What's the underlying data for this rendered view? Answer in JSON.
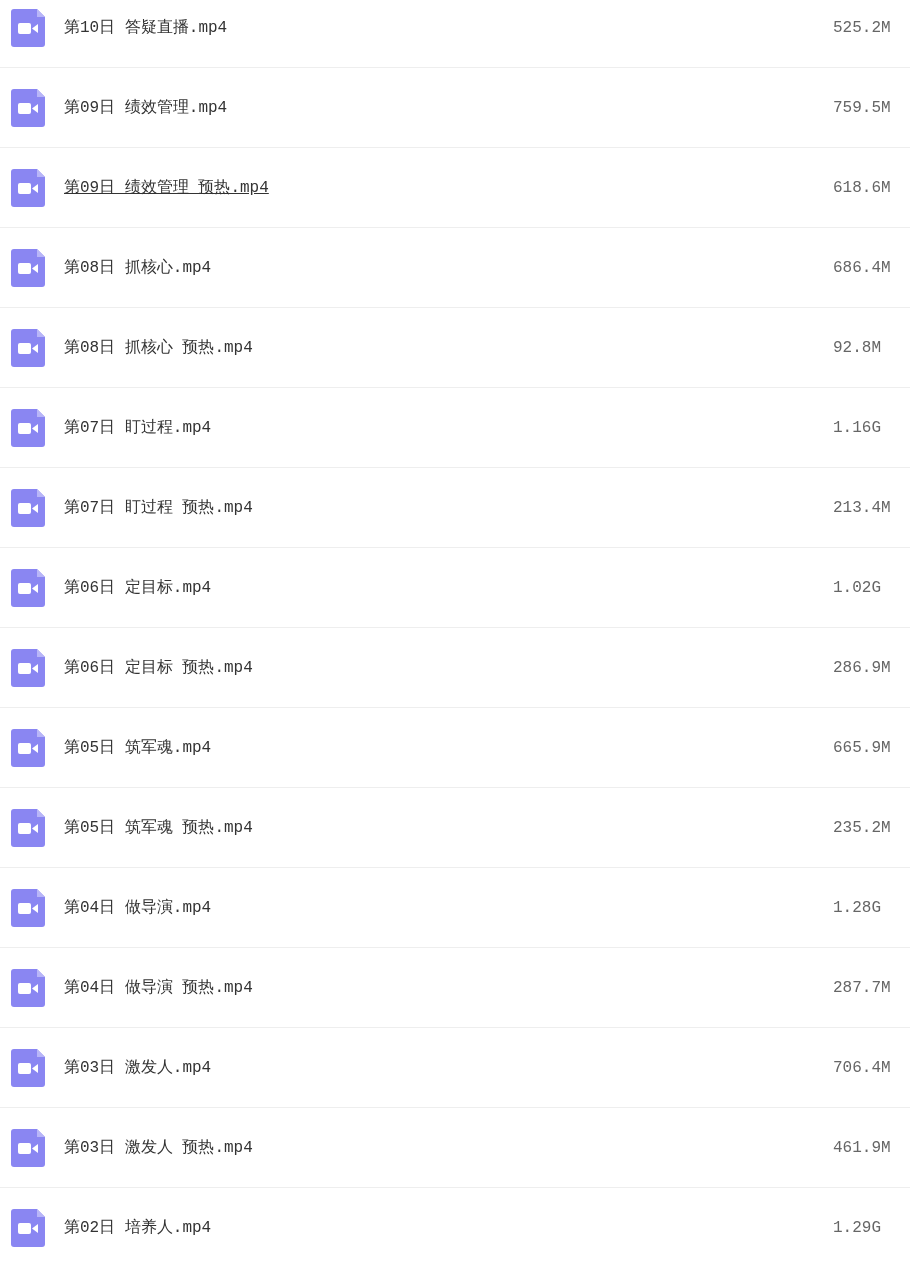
{
  "files": [
    {
      "name": "第10日 答疑直播.mp4",
      "size": "525.2M",
      "hovered": false
    },
    {
      "name": "第09日 绩效管理.mp4",
      "size": "759.5M",
      "hovered": false
    },
    {
      "name": "第09日 绩效管理 预热.mp4",
      "size": "618.6M",
      "hovered": true
    },
    {
      "name": "第08日 抓核心.mp4",
      "size": "686.4M",
      "hovered": false
    },
    {
      "name": "第08日 抓核心 预热.mp4",
      "size": "92.8M",
      "hovered": false
    },
    {
      "name": "第07日 盯过程.mp4",
      "size": "1.16G",
      "hovered": false
    },
    {
      "name": "第07日 盯过程 预热.mp4",
      "size": "213.4M",
      "hovered": false
    },
    {
      "name": "第06日 定目标.mp4",
      "size": "1.02G",
      "hovered": false
    },
    {
      "name": "第06日 定目标 预热.mp4",
      "size": "286.9M",
      "hovered": false
    },
    {
      "name": "第05日 筑军魂.mp4",
      "size": "665.9M",
      "hovered": false
    },
    {
      "name": "第05日 筑军魂 预热.mp4",
      "size": "235.2M",
      "hovered": false
    },
    {
      "name": "第04日 做导演.mp4",
      "size": "1.28G",
      "hovered": false
    },
    {
      "name": "第04日 做导演 预热.mp4",
      "size": "287.7M",
      "hovered": false
    },
    {
      "name": "第03日 激发人.mp4",
      "size": "706.4M",
      "hovered": false
    },
    {
      "name": "第03日 激发人 预热.mp4",
      "size": "461.9M",
      "hovered": false
    },
    {
      "name": "第02日 培养人.mp4",
      "size": "1.29G",
      "hovered": false
    }
  ]
}
